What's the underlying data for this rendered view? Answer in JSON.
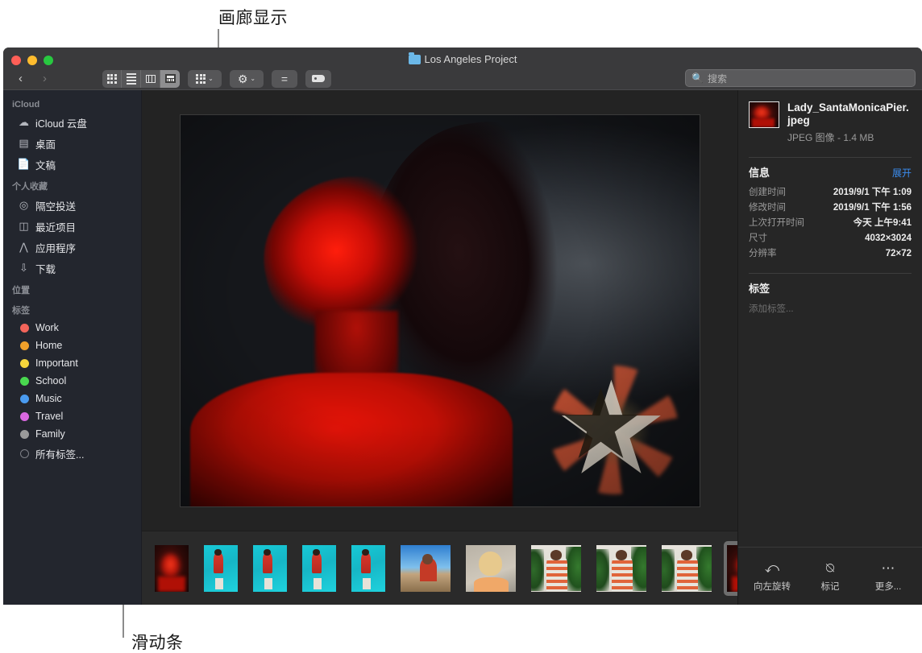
{
  "callouts": [
    {
      "label": "画廊显示",
      "name": "callout-gallery-view"
    },
    {
      "label": "滑动条",
      "name": "callout-filmstrip"
    }
  ],
  "window": {
    "title": "Los Angeles Project",
    "traffic_lights": [
      "close",
      "minimize",
      "zoom"
    ]
  },
  "toolbar": {
    "back": "‹",
    "forward": "›",
    "view_modes": [
      {
        "name": "icon-view",
        "icon": "grid-icon",
        "active": false
      },
      {
        "name": "list-view",
        "icon": "list-icon",
        "active": false
      },
      {
        "name": "column-view",
        "icon": "column-icon",
        "active": false
      },
      {
        "name": "gallery-view",
        "icon": "gallery-icon",
        "active": true
      }
    ],
    "group_button": {
      "icon": "grid-group-icon",
      "chevron": "⌄"
    },
    "action_button": {
      "icon": "gear-icon",
      "chevron": "⌄"
    },
    "share_button": {
      "icon": "share-icon"
    },
    "tag_button": {
      "icon": "tag-icon"
    }
  },
  "search": {
    "placeholder": "搜索",
    "icon": "search-icon",
    "value": ""
  },
  "sidebar": {
    "sections": [
      {
        "header": "iCloud",
        "items": [
          {
            "label": "iCloud 云盘",
            "icon": "cloud-icon"
          },
          {
            "label": "桌面",
            "icon": "desktop-icon"
          },
          {
            "label": "文稿",
            "icon": "documents-icon"
          }
        ]
      },
      {
        "header": "个人收藏",
        "items": [
          {
            "label": "隔空投送",
            "icon": "airdrop-icon"
          },
          {
            "label": "最近项目",
            "icon": "recents-icon"
          },
          {
            "label": "应用程序",
            "icon": "applications-icon"
          },
          {
            "label": "下载",
            "icon": "downloads-icon"
          }
        ]
      },
      {
        "header": "位置",
        "items": []
      },
      {
        "header": "标签",
        "items": [
          {
            "label": "Work",
            "icon": "tag-dot",
            "color": "#f2645a"
          },
          {
            "label": "Home",
            "icon": "tag-dot",
            "color": "#f0a02a"
          },
          {
            "label": "Important",
            "icon": "tag-dot",
            "color": "#f5d53c"
          },
          {
            "label": "School",
            "icon": "tag-dot",
            "color": "#49d84f"
          },
          {
            "label": "Music",
            "icon": "tag-dot",
            "color": "#4a9bf0"
          },
          {
            "label": "Travel",
            "icon": "tag-dot",
            "color": "#d968e0"
          },
          {
            "label": "Family",
            "icon": "tag-dot",
            "color": "#9a9a9a"
          },
          {
            "label": "所有标签...",
            "icon": "tag-dot-hollow",
            "color": "transparent"
          }
        ]
      }
    ]
  },
  "preview": {
    "name": "hero-photo",
    "alt": "红光照亮的微笑女性人像，背景有星形装饰灯"
  },
  "filmstrip": {
    "items": [
      {
        "name": "thumb-1",
        "variant": "t-dark-red",
        "orient": "portrait",
        "selected": false
      },
      {
        "name": "thumb-2",
        "variant": "t-pool",
        "orient": "portrait",
        "selected": false
      },
      {
        "name": "thumb-3",
        "variant": "t-pool",
        "orient": "portrait",
        "selected": false
      },
      {
        "name": "thumb-4",
        "variant": "t-pool",
        "orient": "portrait",
        "selected": false
      },
      {
        "name": "thumb-5",
        "variant": "t-pool",
        "orient": "portrait",
        "selected": false
      },
      {
        "name": "thumb-6",
        "variant": "t-sky",
        "orient": "landscape",
        "selected": false
      },
      {
        "name": "thumb-7",
        "variant": "t-blonde",
        "orient": "landscape",
        "selected": false
      },
      {
        "name": "thumb-8",
        "variant": "t-stripe",
        "orient": "landscape",
        "selected": false
      },
      {
        "name": "thumb-9",
        "variant": "t-stripe",
        "orient": "landscape",
        "selected": false
      },
      {
        "name": "thumb-10",
        "variant": "t-stripe",
        "orient": "landscape",
        "selected": false
      },
      {
        "name": "thumb-11",
        "variant": "t-dark-red",
        "orient": "landscape",
        "selected": true
      }
    ]
  },
  "inspector": {
    "file_name": "Lady_SantaMonicaPier.jpeg",
    "file_sub": "JPEG 图像 - 1.4 MB",
    "info": {
      "title": "信息",
      "action": "展开",
      "rows": [
        {
          "key": "创建时间",
          "value": "2019/9/1 下午 1:09"
        },
        {
          "key": "修改时间",
          "value": "2019/9/1 下午 1:56"
        },
        {
          "key": "上次打开时间",
          "value": "今天 上午9:41"
        },
        {
          "key": "尺寸",
          "value": "4032×3024"
        },
        {
          "key": "分辨率",
          "value": "72×72"
        }
      ]
    },
    "tags": {
      "title": "标签",
      "placeholder": "添加标签..."
    },
    "actions": [
      {
        "label": "向左旋转",
        "icon": "rotate-left-icon",
        "glyph": "⤺"
      },
      {
        "label": "标记",
        "icon": "markup-icon",
        "glyph": "✒"
      },
      {
        "label": "更多...",
        "icon": "more-icon",
        "glyph": "⋯"
      }
    ]
  },
  "colors": {
    "accent": "#3b8df0",
    "titlebar": "#3a3a3c",
    "sidebar": "#23262e",
    "content": "#232323",
    "inspector": "#262626",
    "filmstrip": "#2a2a2a"
  }
}
